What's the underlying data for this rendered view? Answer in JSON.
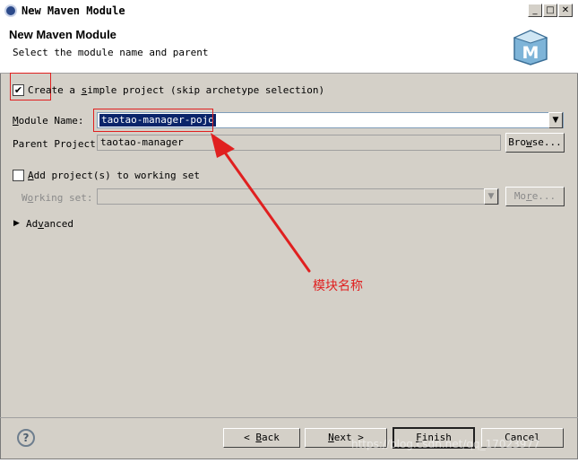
{
  "window": {
    "title": "New Maven Module",
    "minimize": "_",
    "maximize": "□",
    "close": "✕"
  },
  "header": {
    "title": "New Maven Module",
    "subtitle": "Select the module name and parent",
    "logo_letter": "M"
  },
  "form": {
    "simple_project": {
      "label_pre": "Create a ",
      "label_key": "s",
      "label_post": "imple project (skip archetype selection)",
      "checked": "✔"
    },
    "module_name": {
      "label_key": "M",
      "label_post": "odule Name:",
      "value": "taotao-manager-pojo",
      "arrow": "▼"
    },
    "parent_project": {
      "label": "Parent Project:",
      "value": "taotao-manager",
      "browse_pre": "Bro",
      "browse_key": "w",
      "browse_post": "se..."
    },
    "working_set_add": {
      "label_key": "A",
      "label_post": "dd project(s) to working set"
    },
    "working_set": {
      "label_pre": "W",
      "label_key": "o",
      "label_post": "rking set:",
      "arrow": "▼",
      "more_pre": "Mo",
      "more_key": "r",
      "more_post": "e..."
    },
    "advanced": {
      "arrow": "▶",
      "label_pre": "Ad",
      "label_key": "v",
      "label_post": "anced"
    }
  },
  "annotation": {
    "text": "模块名称",
    "color": "#e02020"
  },
  "footer": {
    "help": "?",
    "back_pre": "< ",
    "back_key": "B",
    "back_post": "ack",
    "next_key": "N",
    "next_post": "ext >",
    "finish_key": "F",
    "finish_post": "inish",
    "cancel": "Cancel"
  },
  "watermark": "https://blog.csdn.net/qq_17023977"
}
